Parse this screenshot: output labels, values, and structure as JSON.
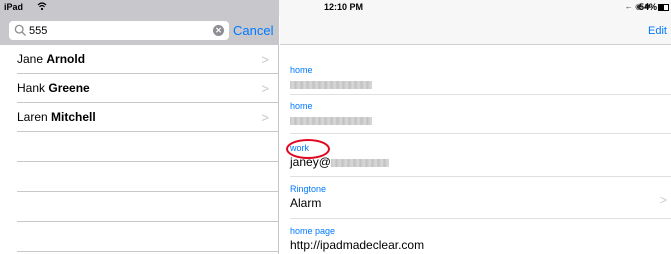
{
  "status_bar": {
    "carrier": "iPad",
    "time": "12:10 PM",
    "battery": "54%",
    "icons": [
      "wifi-icon",
      "location-icon",
      "alarm-icon",
      "bluetooth-icon",
      "battery-icon"
    ]
  },
  "search": {
    "value": "555",
    "cancel_label": "Cancel"
  },
  "contacts": [
    {
      "first": "Jane",
      "last": "Arnold"
    },
    {
      "first": "Hank",
      "last": "Greene"
    },
    {
      "first": "Laren",
      "last": "Mitchell"
    }
  ],
  "detail": {
    "edit_label": "Edit",
    "fields": [
      {
        "label": "home",
        "value": ""
      },
      {
        "label": "home",
        "value": ""
      },
      {
        "label": "work",
        "value": "janey@"
      },
      {
        "label": "Ringtone",
        "value": "Alarm"
      },
      {
        "label": "home page",
        "value": "http://ipadmadeclear.com"
      }
    ]
  },
  "colors": {
    "accent": "#007aff",
    "highlight_circle": "#e1061f",
    "search_bar_bg": "#c7c7cc"
  }
}
